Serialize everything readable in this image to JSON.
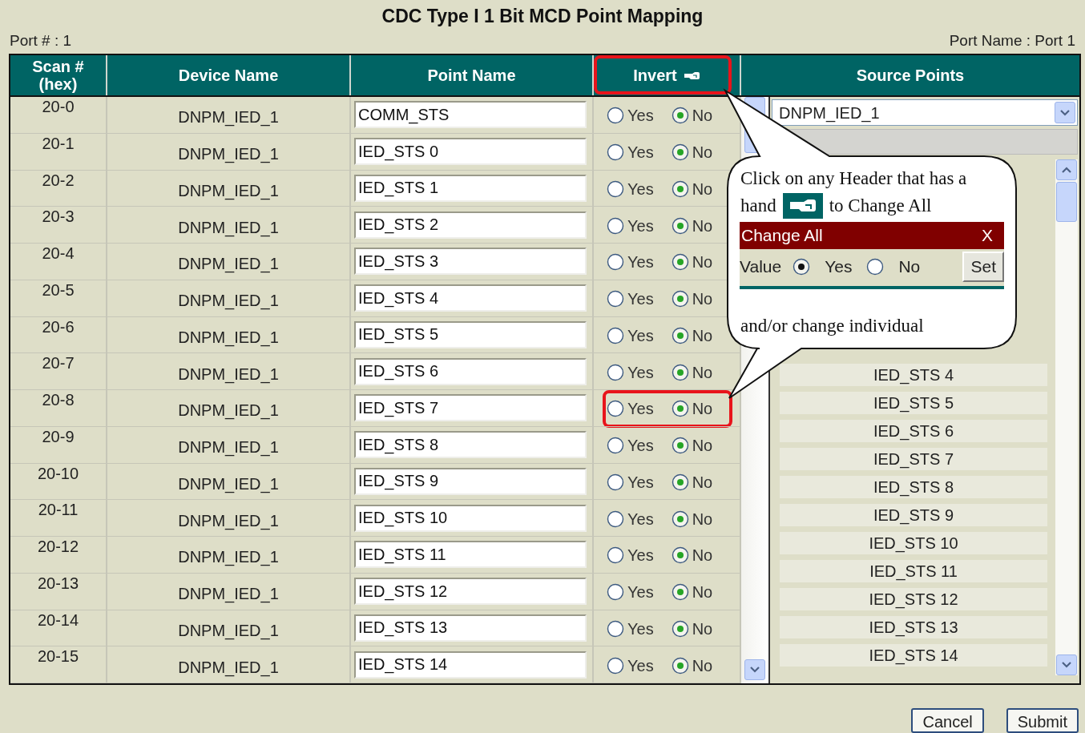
{
  "title": "CDC Type I 1 Bit MCD Point Mapping",
  "port_number": "Port # : 1",
  "port_name": "Port Name : Port 1",
  "columns": [
    "Scan # (hex)",
    "Device Name",
    "Point Name",
    "Invert",
    "Source Points"
  ],
  "rows": [
    {
      "scan": "20-0",
      "device": "DNPM_IED_1",
      "point": "COMM_STS",
      "options": [
        {
          "label": "Yes",
          "selected": false
        },
        {
          "label": "No",
          "selected": true
        }
      ]
    },
    {
      "scan": "20-1",
      "device": "DNPM_IED_1",
      "point": "IED_STS 0",
      "options": [
        {
          "label": "Yes",
          "selected": false
        },
        {
          "label": "No",
          "selected": true
        }
      ]
    },
    {
      "scan": "20-2",
      "device": "DNPM_IED_1",
      "point": "IED_STS 1",
      "options": [
        {
          "label": "Yes",
          "selected": false
        },
        {
          "label": "No",
          "selected": true
        }
      ]
    },
    {
      "scan": "20-3",
      "device": "DNPM_IED_1",
      "point": "IED_STS 2",
      "options": [
        {
          "label": "Yes",
          "selected": false
        },
        {
          "label": "No",
          "selected": true
        }
      ]
    },
    {
      "scan": "20-4",
      "device": "DNPM_IED_1",
      "point": "IED_STS 3",
      "options": [
        {
          "label": "Yes",
          "selected": false
        },
        {
          "label": "No",
          "selected": true
        }
      ]
    },
    {
      "scan": "20-5",
      "device": "DNPM_IED_1",
      "point": "IED_STS 4",
      "options": [
        {
          "label": "Yes",
          "selected": false
        },
        {
          "label": "No",
          "selected": true
        }
      ]
    },
    {
      "scan": "20-6",
      "device": "DNPM_IED_1",
      "point": "IED_STS 5",
      "options": [
        {
          "label": "Yes",
          "selected": false
        },
        {
          "label": "No",
          "selected": true
        }
      ]
    },
    {
      "scan": "20-7",
      "device": "DNPM_IED_1",
      "point": "IED_STS 6",
      "options": [
        {
          "label": "Yes",
          "selected": false
        },
        {
          "label": "No",
          "selected": true
        }
      ]
    },
    {
      "scan": "20-8",
      "device": "DNPM_IED_1",
      "point": "IED_STS 7",
      "options": [
        {
          "label": "Yes",
          "selected": false
        },
        {
          "label": "No",
          "selected": true
        }
      ]
    },
    {
      "scan": "20-9",
      "device": "DNPM_IED_1",
      "point": "IED_STS 8",
      "options": [
        {
          "label": "Yes",
          "selected": false
        },
        {
          "label": "No",
          "selected": true
        }
      ]
    },
    {
      "scan": "20-10",
      "device": "DNPM_IED_1",
      "point": "IED_STS 9",
      "options": [
        {
          "label": "Yes",
          "selected": false
        },
        {
          "label": "No",
          "selected": true
        }
      ]
    },
    {
      "scan": "20-11",
      "device": "DNPM_IED_1",
      "point": "IED_STS 10",
      "options": [
        {
          "label": "Yes",
          "selected": false
        },
        {
          "label": "No",
          "selected": true
        }
      ]
    },
    {
      "scan": "20-12",
      "device": "DNPM_IED_1",
      "point": "IED_STS 11",
      "options": [
        {
          "label": "Yes",
          "selected": false
        },
        {
          "label": "No",
          "selected": true
        }
      ]
    },
    {
      "scan": "20-13",
      "device": "DNPM_IED_1",
      "point": "IED_STS 12",
      "options": [
        {
          "label": "Yes",
          "selected": false
        },
        {
          "label": "No",
          "selected": true
        }
      ]
    },
    {
      "scan": "20-14",
      "device": "DNPM_IED_1",
      "point": "IED_STS 13",
      "options": [
        {
          "label": "Yes",
          "selected": false
        },
        {
          "label": "No",
          "selected": true
        }
      ]
    },
    {
      "scan": "20-15",
      "device": "DNPM_IED_1",
      "point": "IED_STS 14",
      "options": [
        {
          "label": "Yes",
          "selected": false
        },
        {
          "label": "No",
          "selected": true
        }
      ]
    }
  ],
  "source_points": {
    "device_select": "DNPM_IED_1",
    "items": [
      "IED_STS 4",
      "IED_STS 5",
      "IED_STS 6",
      "IED_STS 7",
      "IED_STS 8",
      "IED_STS 9",
      "IED_STS 10",
      "IED_STS 11",
      "IED_STS 12",
      "IED_STS 13",
      "IED_STS 14"
    ]
  },
  "callout": {
    "line_1": "Click on any Header that has a",
    "line_2a": "hand",
    "line_2b": "to Change All",
    "dialog": {
      "title": "Change All",
      "close": "X",
      "value_label": "Value",
      "options": [
        {
          "label": "Yes",
          "selected": true
        },
        {
          "label": "No",
          "selected": false
        }
      ],
      "set": "Set"
    },
    "footer": "and/or change individual"
  },
  "buttons": [
    "Cancel",
    "Submit"
  ]
}
